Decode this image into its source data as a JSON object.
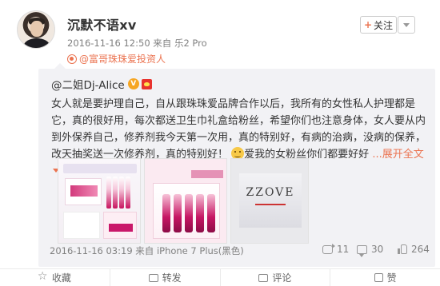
{
  "post": {
    "username": "沉默不语xv",
    "meta": "2016-11-16 12:50 来自 乐2 Pro",
    "identity": "@富哥珠珠爱投资人",
    "follow_label": "关注",
    "follow_plus": "+"
  },
  "repost": {
    "author": "@二姐Dj-Alice",
    "verified_mark": "V",
    "text_main": "女人就是要护理自己，自从跟珠珠爱品牌合作以后，我所有的女性私人护理都是它，真的很好用，每次都送卫生巾礼盒给粉丝，希望你们也注意身体，女人要从内到外保养自己，修养剂我今天第一次用，真的特别好，有病的治病，没病的保养，改天抽奖送一次修养剂，真的特别好！",
    "text_tail": "爱我的女粉丝你们都要好好",
    "expand_label": "...展开全文",
    "thumb_logo": "ZZOVE",
    "footer_meta": "2016-11-16 03:19 来自 iPhone 7 Plus(黑色)",
    "stats": {
      "reposts": "11",
      "comments": "30",
      "likes": "264"
    }
  },
  "actions": [
    {
      "label": "收藏",
      "icon": "star-icon"
    },
    {
      "label": "转发",
      "icon": "repost-icon"
    },
    {
      "label": "评论",
      "icon": "comment-icon"
    },
    {
      "label": "赞",
      "icon": "like-icon"
    }
  ],
  "colors": {
    "accent": "#eb7350",
    "repost_bg": "#f2f2f5"
  }
}
